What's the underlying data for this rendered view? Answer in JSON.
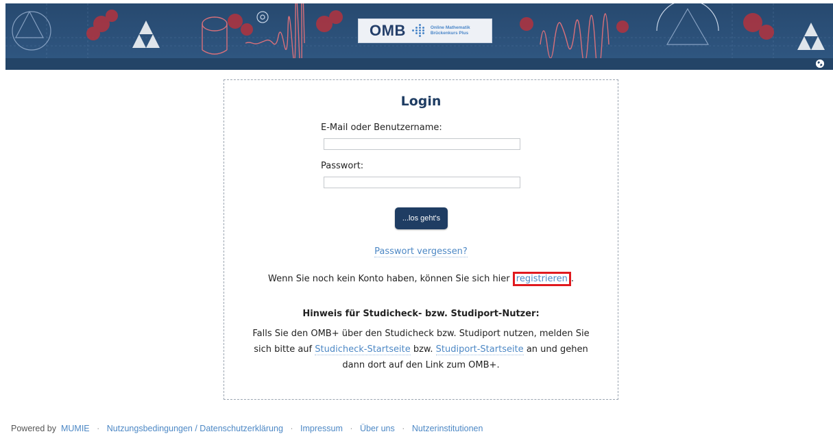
{
  "header": {
    "logo_text": "OMB",
    "logo_subtitle_line1": "Online Mathematik",
    "logo_subtitle_line2": "Brückenkurs Plus",
    "globe_icon": "globe-icon"
  },
  "login": {
    "title": "Login",
    "username_label": "E-Mail oder Benutzername:",
    "username_value": "",
    "password_label": "Passwort:",
    "password_value": "",
    "submit_label": "...los geht's",
    "forgot_label": "Passwort vergessen?",
    "register_prefix": "Wenn Sie noch kein Konto haben, können Sie sich hier",
    "register_link": "registrieren",
    "register_suffix": "."
  },
  "hint": {
    "title": "Hinweis für Studicheck- bzw. Studiport-Nutzer:",
    "text_part1": "Falls Sie den OMB+ über den Studicheck bzw. Studiport nutzen, melden Sie sich bitte auf",
    "link1": "Studicheck-Startseite",
    "text_part2": "bzw.",
    "link2": "Studiport-Startseite",
    "text_part3": "an und gehen dann dort auf den Link zum OMB+."
  },
  "footer": {
    "powered_by": "Powered by",
    "links": [
      "MUMIE",
      "Nutzungsbedingungen / Datenschutzerklärung",
      "Impressum",
      "Über uns",
      "Nutzerinstitutionen"
    ],
    "separator": "·"
  },
  "colors": {
    "banner": "#2c4a6e",
    "button": "#1f3d63",
    "link": "#4d88c5",
    "highlight": "#e0191e"
  }
}
